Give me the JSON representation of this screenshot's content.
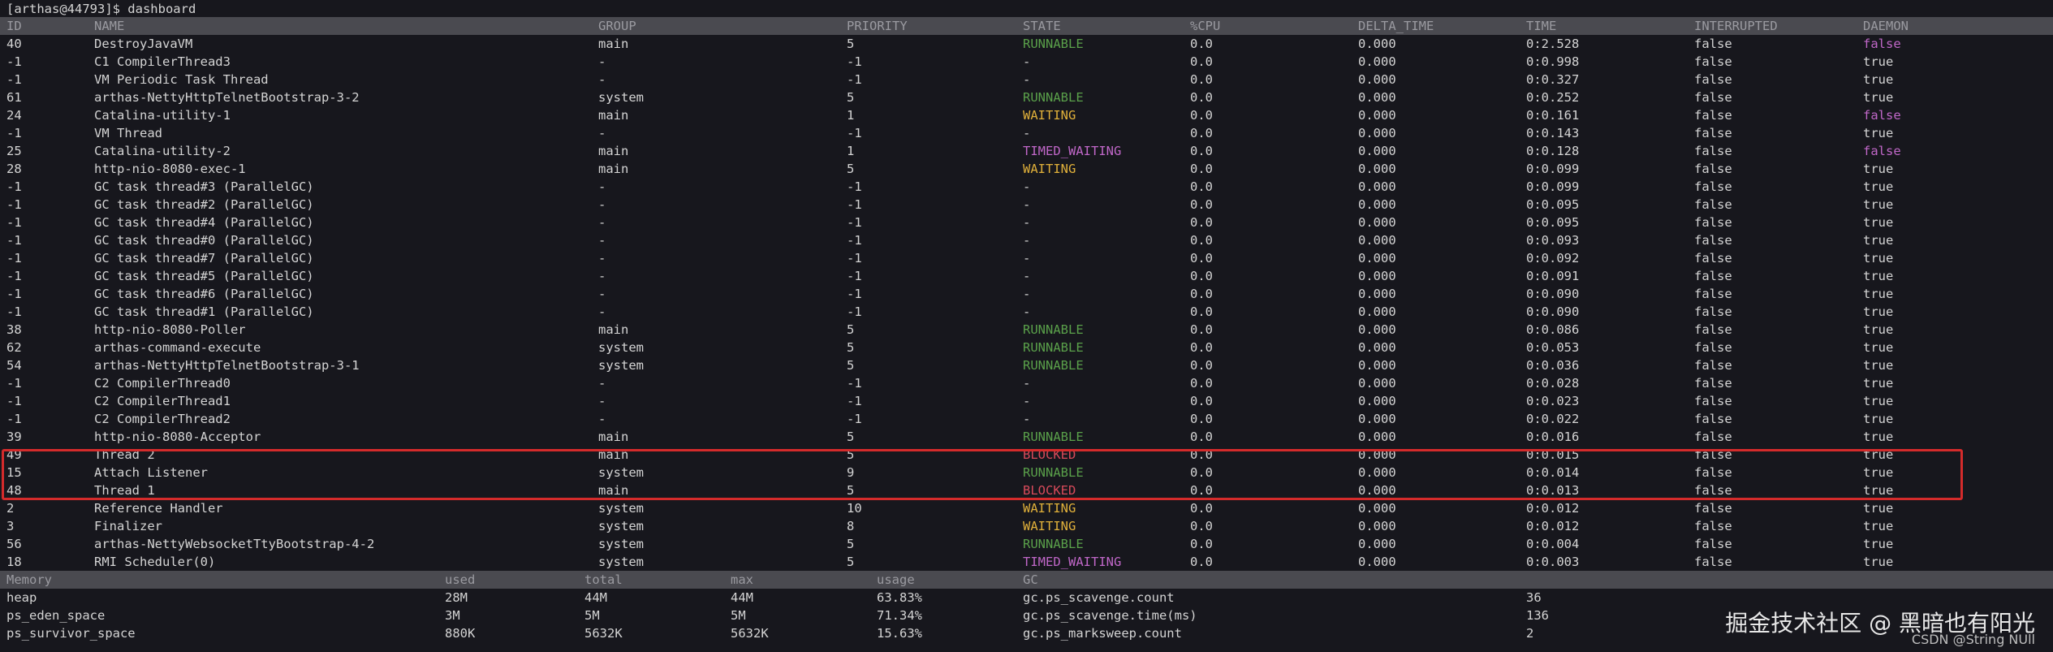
{
  "prompt": "[arthas@44793]$ dashboard",
  "thread_headers": [
    "ID",
    "NAME",
    "GROUP",
    "PRIORITY",
    "STATE",
    "%CPU",
    "DELTA_TIME",
    "TIME",
    "INTERRUPTED",
    "DAEMON"
  ],
  "threads": [
    [
      "40",
      "DestroyJavaVM",
      "main",
      "5",
      "RUNNABLE",
      "0.0",
      "0.000",
      "0:2.528",
      "false",
      "false"
    ],
    [
      "-1",
      "C1 CompilerThread3",
      "-",
      "-1",
      "-",
      "0.0",
      "0.000",
      "0:0.998",
      "false",
      "true"
    ],
    [
      "-1",
      "VM Periodic Task Thread",
      "-",
      "-1",
      "-",
      "0.0",
      "0.000",
      "0:0.327",
      "false",
      "true"
    ],
    [
      "61",
      "arthas-NettyHttpTelnetBootstrap-3-2",
      "system",
      "5",
      "RUNNABLE",
      "0.0",
      "0.000",
      "0:0.252",
      "false",
      "true"
    ],
    [
      "24",
      "Catalina-utility-1",
      "main",
      "1",
      "WAITING",
      "0.0",
      "0.000",
      "0:0.161",
      "false",
      "false"
    ],
    [
      "-1",
      "VM Thread",
      "-",
      "-1",
      "-",
      "0.0",
      "0.000",
      "0:0.143",
      "false",
      "true"
    ],
    [
      "25",
      "Catalina-utility-2",
      "main",
      "1",
      "TIMED_WAITING",
      "0.0",
      "0.000",
      "0:0.128",
      "false",
      "false"
    ],
    [
      "28",
      "http-nio-8080-exec-1",
      "main",
      "5",
      "WAITING",
      "0.0",
      "0.000",
      "0:0.099",
      "false",
      "true"
    ],
    [
      "-1",
      "GC task thread#3 (ParallelGC)",
      "-",
      "-1",
      "-",
      "0.0",
      "0.000",
      "0:0.099",
      "false",
      "true"
    ],
    [
      "-1",
      "GC task thread#2 (ParallelGC)",
      "-",
      "-1",
      "-",
      "0.0",
      "0.000",
      "0:0.095",
      "false",
      "true"
    ],
    [
      "-1",
      "GC task thread#4 (ParallelGC)",
      "-",
      "-1",
      "-",
      "0.0",
      "0.000",
      "0:0.095",
      "false",
      "true"
    ],
    [
      "-1",
      "GC task thread#0 (ParallelGC)",
      "-",
      "-1",
      "-",
      "0.0",
      "0.000",
      "0:0.093",
      "false",
      "true"
    ],
    [
      "-1",
      "GC task thread#7 (ParallelGC)",
      "-",
      "-1",
      "-",
      "0.0",
      "0.000",
      "0:0.092",
      "false",
      "true"
    ],
    [
      "-1",
      "GC task thread#5 (ParallelGC)",
      "-",
      "-1",
      "-",
      "0.0",
      "0.000",
      "0:0.091",
      "false",
      "true"
    ],
    [
      "-1",
      "GC task thread#6 (ParallelGC)",
      "-",
      "-1",
      "-",
      "0.0",
      "0.000",
      "0:0.090",
      "false",
      "true"
    ],
    [
      "-1",
      "GC task thread#1 (ParallelGC)",
      "-",
      "-1",
      "-",
      "0.0",
      "0.000",
      "0:0.090",
      "false",
      "true"
    ],
    [
      "38",
      "http-nio-8080-Poller",
      "main",
      "5",
      "RUNNABLE",
      "0.0",
      "0.000",
      "0:0.086",
      "false",
      "true"
    ],
    [
      "62",
      "arthas-command-execute",
      "system",
      "5",
      "RUNNABLE",
      "0.0",
      "0.000",
      "0:0.053",
      "false",
      "true"
    ],
    [
      "54",
      "arthas-NettyHttpTelnetBootstrap-3-1",
      "system",
      "5",
      "RUNNABLE",
      "0.0",
      "0.000",
      "0:0.036",
      "false",
      "true"
    ],
    [
      "-1",
      "C2 CompilerThread0",
      "-",
      "-1",
      "-",
      "0.0",
      "0.000",
      "0:0.028",
      "false",
      "true"
    ],
    [
      "-1",
      "C2 CompilerThread1",
      "-",
      "-1",
      "-",
      "0.0",
      "0.000",
      "0:0.023",
      "false",
      "true"
    ],
    [
      "-1",
      "C2 CompilerThread2",
      "-",
      "-1",
      "-",
      "0.0",
      "0.000",
      "0:0.022",
      "false",
      "true"
    ],
    [
      "39",
      "http-nio-8080-Acceptor",
      "main",
      "5",
      "RUNNABLE",
      "0.0",
      "0.000",
      "0:0.016",
      "false",
      "true"
    ],
    [
      "49",
      "Thread 2",
      "main",
      "5",
      "BLOCKED",
      "0.0",
      "0.000",
      "0:0.015",
      "false",
      "true"
    ],
    [
      "15",
      "Attach Listener",
      "system",
      "9",
      "RUNNABLE",
      "0.0",
      "0.000",
      "0:0.014",
      "false",
      "true"
    ],
    [
      "48",
      "Thread 1",
      "main",
      "5",
      "BLOCKED",
      "0.0",
      "0.000",
      "0:0.013",
      "false",
      "true"
    ],
    [
      "2",
      "Reference Handler",
      "system",
      "10",
      "WAITING",
      "0.0",
      "0.000",
      "0:0.012",
      "false",
      "true"
    ],
    [
      "3",
      "Finalizer",
      "system",
      "8",
      "WAITING",
      "0.0",
      "0.000",
      "0:0.012",
      "false",
      "true"
    ],
    [
      "56",
      "arthas-NettyWebsocketTtyBootstrap-4-2",
      "system",
      "5",
      "RUNNABLE",
      "0.0",
      "0.000",
      "0:0.004",
      "false",
      "true"
    ],
    [
      "18",
      "RMI Scheduler(0)",
      "system",
      "5",
      "TIMED_WAITING",
      "0.0",
      "0.000",
      "0:0.003",
      "false",
      "true"
    ]
  ],
  "memory_headers": [
    "Memory",
    "used",
    "total",
    "max",
    "usage",
    "GC",
    ""
  ],
  "memory": [
    [
      "heap",
      "28M",
      "44M",
      "44M",
      "63.83%",
      "gc.ps_scavenge.count",
      "36"
    ],
    [
      "ps_eden_space",
      "3M",
      "5M",
      "5M",
      "71.34%",
      "gc.ps_scavenge.time(ms)",
      "136"
    ],
    [
      "ps_survivor_space",
      "880K",
      "5632K",
      "5632K",
      "15.63%",
      "gc.ps_marksweep.count",
      "2"
    ]
  ],
  "state_colors": {
    "RUNNABLE": "#5aa04a",
    "WAITING": "#e0b03a",
    "TIMED_WAITING": "#c067c8",
    "BLOCKED": "#d74a5a"
  },
  "daemon_false_color": "#c067c8",
  "highlight_color": "#d42b2b",
  "watermark": "掘金技术社区 @ 黑暗也有阳光",
  "watermark_sub": "CSDN @String NUll"
}
